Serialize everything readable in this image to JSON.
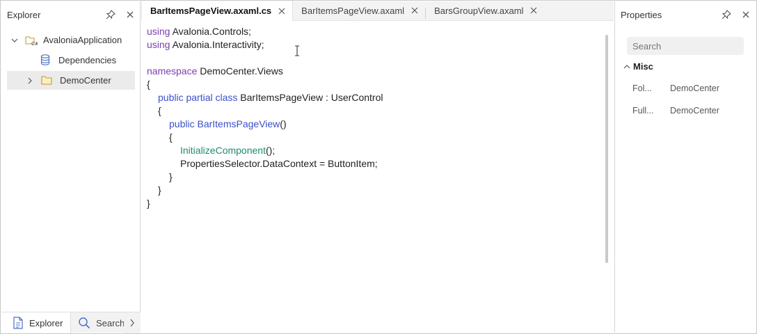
{
  "explorer": {
    "title": "Explorer",
    "tree": [
      {
        "label": "AvaloniaApplication",
        "expanded": true,
        "icon": "csharp-project-icon"
      },
      {
        "label": "Dependencies",
        "icon": "database-icon"
      },
      {
        "label": "DemoCenter",
        "expanded": false,
        "icon": "folder-icon",
        "selected": true
      }
    ],
    "bottom_tabs": [
      {
        "label": "Explorer",
        "icon": "document-icon",
        "active": true
      },
      {
        "label": "Search",
        "icon": "search-icon",
        "active": false
      }
    ]
  },
  "editor": {
    "tabs": [
      {
        "label": "BarItemsPageView.axaml.cs",
        "active": true
      },
      {
        "label": "BarItemsPageView.axaml",
        "active": false
      },
      {
        "label": "BarsGroupView.axaml",
        "active": false
      }
    ],
    "code": {
      "l1_kw": "using",
      "l1_rest": " Avalonia.Controls;",
      "l2_kw": "using",
      "l2_rest": " Avalonia.Interactivity;",
      "l4_kw": "namespace",
      "l4_rest": " DemoCenter.Views",
      "l5": "{",
      "l6_kw1": "public",
      "l6_kw2": "partial",
      "l6_kw3": "class",
      "l6_rest": " BarItemsPageView : UserControl",
      "l7": "{",
      "l8_kw": "public",
      "l8_fn": "BarItemsPageView",
      "l8_rest": "()",
      "l9": "{",
      "l10_fn": "InitializeComponent",
      "l10_rest": "();",
      "l11": "PropertiesSelector.DataContext = ButtonItem;",
      "l12": "}",
      "l13": "}",
      "l14": "}"
    }
  },
  "properties": {
    "title": "Properties",
    "search_placeholder": "Search",
    "category": "Misc",
    "rows": [
      {
        "name": "Fol...",
        "value": "DemoCenter"
      },
      {
        "name": "Full...",
        "value": "DemoCenter"
      }
    ]
  },
  "colors": {
    "keyword": "#7a3fb0",
    "keyword_blue": "#3b50c8",
    "method": "#1f8a6f",
    "selected_row": "#ebebeb"
  }
}
